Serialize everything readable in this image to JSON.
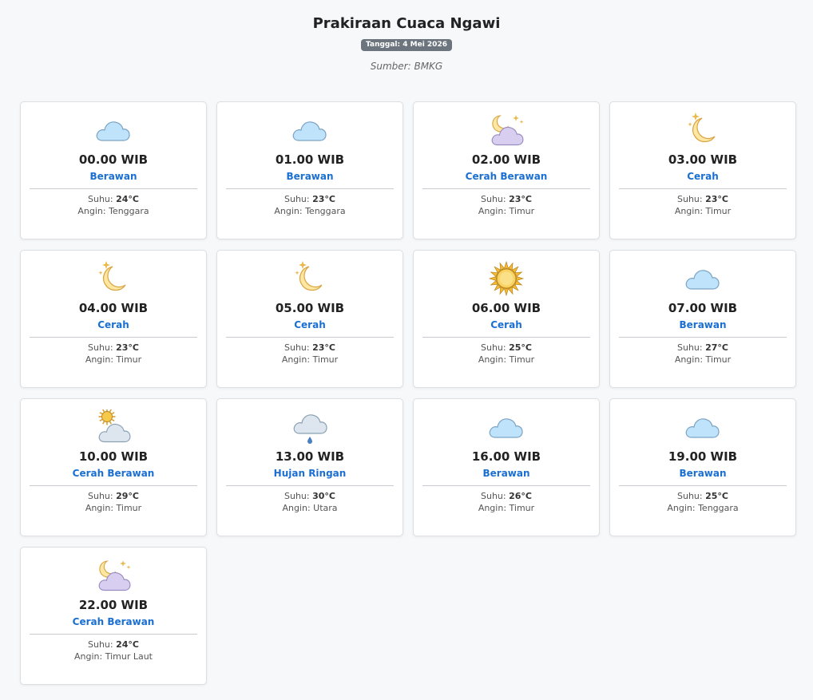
{
  "header": {
    "title": "Prakiraan Cuaca Ngawi",
    "date_badge": "Tanggal: 4 Mei 2026",
    "source": "Sumber: BMKG"
  },
  "labels": {
    "temp_prefix": "Suhu:",
    "wind_prefix": "Angin:"
  },
  "forecasts": [
    {
      "time": "00.00 WIB",
      "desc": "Berawan",
      "icon": "cloud-icon",
      "temp": "24°C",
      "wind": "Tenggara"
    },
    {
      "time": "01.00 WIB",
      "desc": "Berawan",
      "icon": "cloud-icon",
      "temp": "23°C",
      "wind": "Tenggara"
    },
    {
      "time": "02.00 WIB",
      "desc": "Cerah Berawan",
      "icon": "moon-cloud-icon",
      "temp": "23°C",
      "wind": "Timur"
    },
    {
      "time": "03.00 WIB",
      "desc": "Cerah",
      "icon": "moon-icon",
      "temp": "23°C",
      "wind": "Timur"
    },
    {
      "time": "04.00 WIB",
      "desc": "Cerah",
      "icon": "moon-icon",
      "temp": "23°C",
      "wind": "Timur"
    },
    {
      "time": "05.00 WIB",
      "desc": "Cerah",
      "icon": "moon-icon",
      "temp": "23°C",
      "wind": "Timur"
    },
    {
      "time": "06.00 WIB",
      "desc": "Cerah",
      "icon": "sun-icon",
      "temp": "25°C",
      "wind": "Timur"
    },
    {
      "time": "07.00 WIB",
      "desc": "Berawan",
      "icon": "cloud-icon",
      "temp": "27°C",
      "wind": "Timur"
    },
    {
      "time": "10.00 WIB",
      "desc": "Cerah Berawan",
      "icon": "sun-cloud-icon",
      "temp": "29°C",
      "wind": "Timur"
    },
    {
      "time": "13.00 WIB",
      "desc": "Hujan Ringan",
      "icon": "rain-cloud-icon",
      "temp": "30°C",
      "wind": "Utara"
    },
    {
      "time": "16.00 WIB",
      "desc": "Berawan",
      "icon": "cloud-icon",
      "temp": "26°C",
      "wind": "Timur"
    },
    {
      "time": "19.00 WIB",
      "desc": "Berawan",
      "icon": "cloud-icon",
      "temp": "25°C",
      "wind": "Tenggara"
    },
    {
      "time": "22.00 WIB",
      "desc": "Cerah Berawan",
      "icon": "moon-cloud-icon",
      "temp": "24°C",
      "wind": "Timur Laut"
    }
  ],
  "colors": {
    "accent": "#1a6fd1",
    "badge": "#6c757d",
    "cloud_blue": "#bfe3fb",
    "cloud_purple": "#d8cff0",
    "cloud_grey": "#dde6ee",
    "sun": "#f7c948",
    "moon": "#fde7a3"
  }
}
